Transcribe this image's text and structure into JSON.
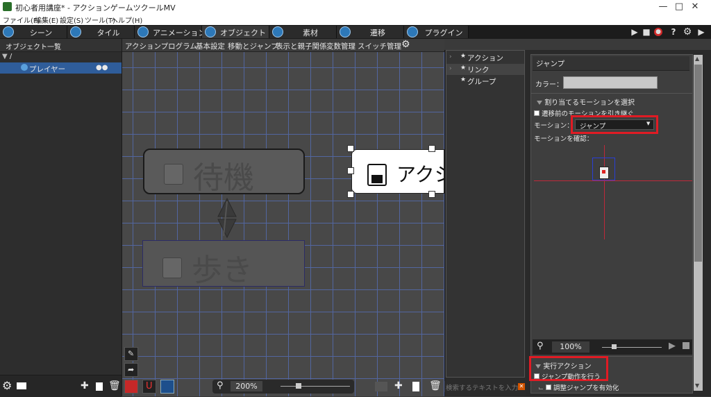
{
  "window": {
    "title": "初心者用講座* - アクションゲームツクールMV",
    "minimize_icon": "minimize-icon",
    "maximize_icon": "maximize-icon",
    "close_icon": "close-icon"
  },
  "menubar": [
    "ファイル(F)",
    "編集(E)",
    "設定(S)",
    "ツール(T)",
    "ヘルプ(H)"
  ],
  "tabs": [
    {
      "label": "シーン",
      "icon": "scene-icon"
    },
    {
      "label": "タイル",
      "icon": "tile-icon"
    },
    {
      "label": "アニメーション",
      "icon": "animation-icon"
    },
    {
      "label": "オブジェクト",
      "icon": "object-icon"
    },
    {
      "label": "素材",
      "icon": "resource-icon"
    },
    {
      "label": "遷移",
      "icon": "transition-icon"
    },
    {
      "label": "プラグイン",
      "icon": "plugin-icon"
    }
  ],
  "toolbar_right": {
    "help": "?"
  },
  "object_list": {
    "header": "オブジェクト一覧",
    "root": "/",
    "items": [
      {
        "label": "プレイヤー"
      }
    ]
  },
  "canvas_tabs": [
    "アクションプログラム",
    "基本設定",
    "移動とジャンプ",
    "表示と親子関係",
    "変数管理",
    "スイッチ管理"
  ],
  "canvas": {
    "nodes": [
      {
        "label": "待機"
      },
      {
        "label": "歩き"
      },
      {
        "label": "アクシ"
      }
    ],
    "zoom": "200%"
  },
  "middle_list": {
    "items": [
      {
        "label": "アクション"
      },
      {
        "label": "リンク"
      },
      {
        "label": "グループ"
      }
    ],
    "search_placeholder": "検索するテキストを入力"
  },
  "properties": {
    "title": "ジャンプ",
    "color_label": "カラー：",
    "motion_section": "割り当てるモーションを選択",
    "inherit_checkbox": "遷移前のモーションを引き継ぐ",
    "motion_label": "モーション：",
    "motion_value": "ジャンプ",
    "preview_label": "モーションを確認：",
    "preview_zoom": "100%",
    "exec_section": "実行アクション",
    "exec_checkbox": "ジャンプ動作を行う",
    "adjust_checkbox": "調整ジャンプを有効化"
  },
  "colors": {
    "highlight": "#e01b24",
    "selection": "#2f5d9a",
    "grid": "#5266a0"
  }
}
